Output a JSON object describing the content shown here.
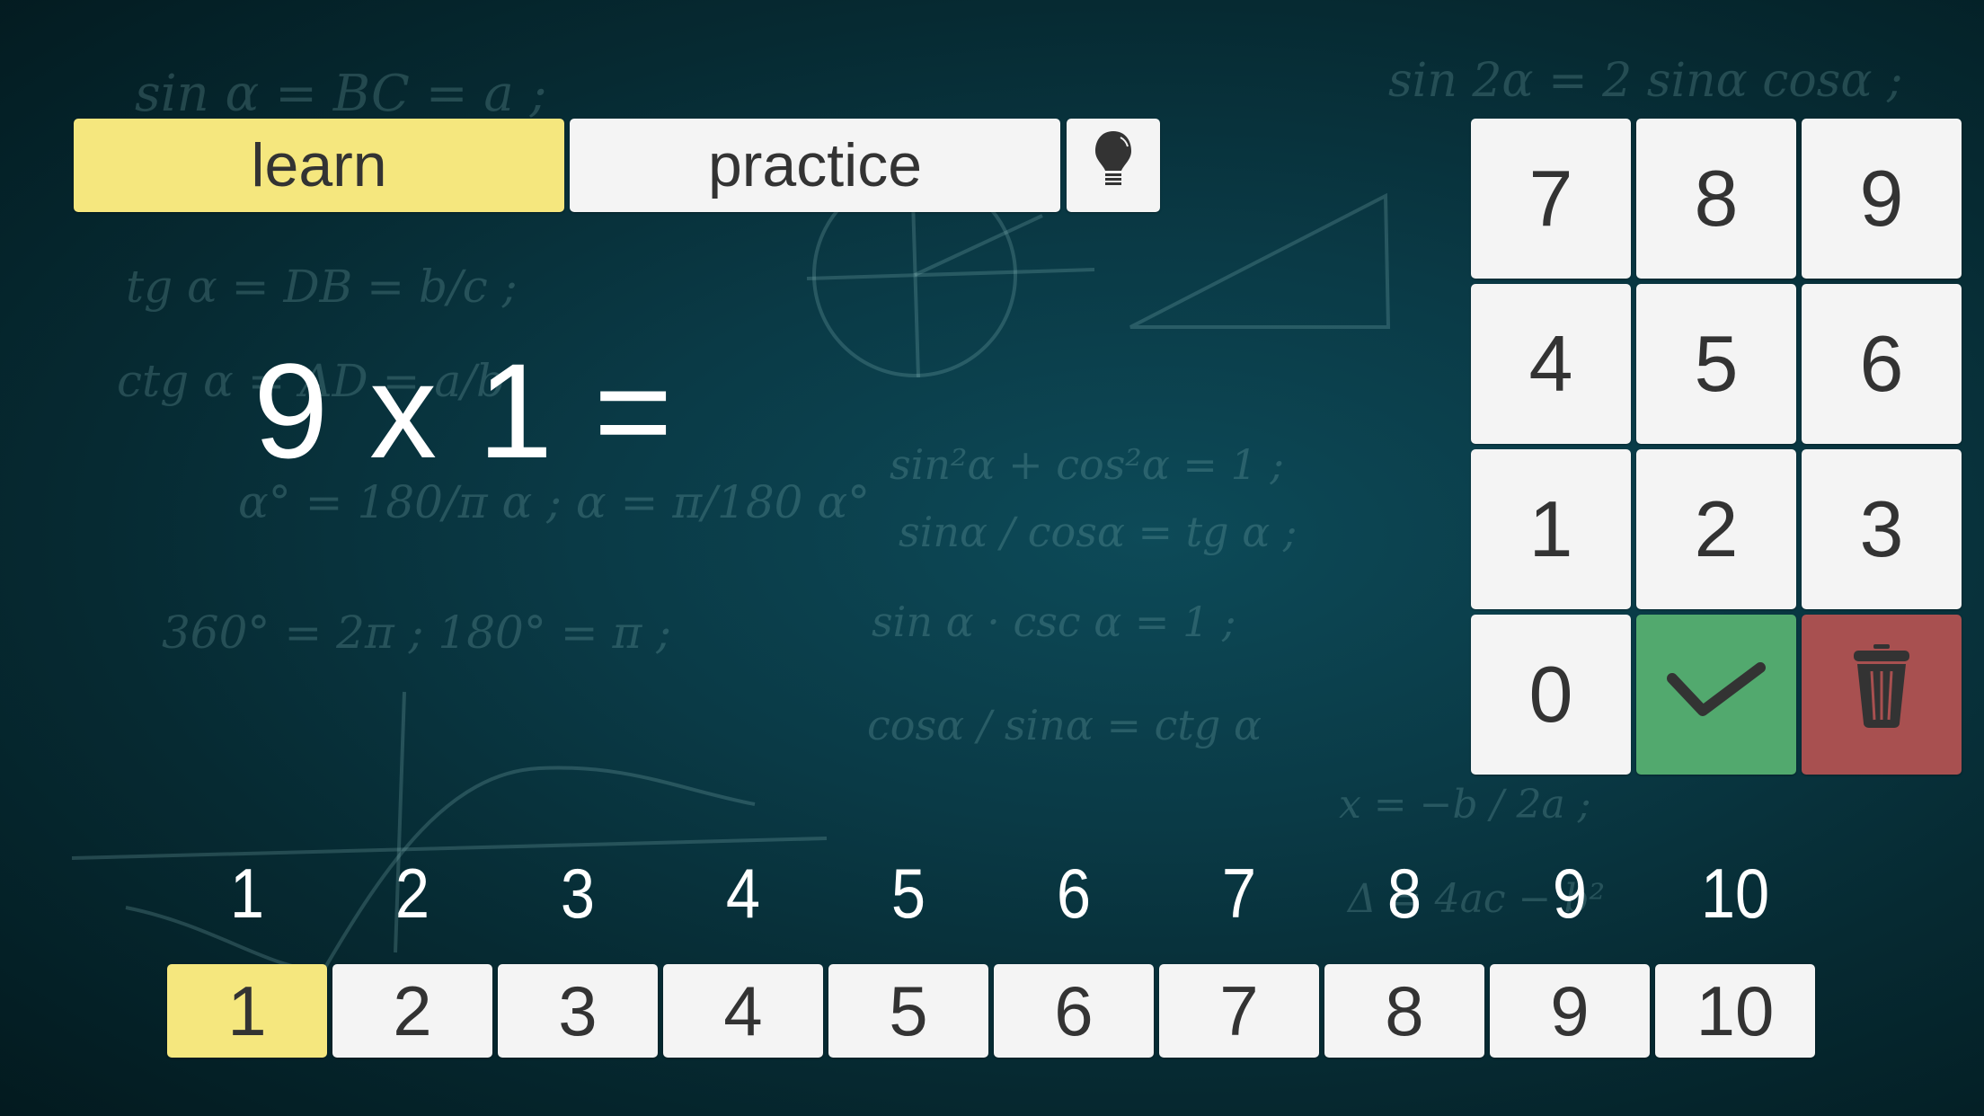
{
  "mode_tabs": {
    "learn_label": "learn",
    "practice_label": "practice",
    "active": "learn",
    "hint_icon": "lightbulb-icon"
  },
  "question": {
    "text": "9 x 1 ="
  },
  "keypad": {
    "keys": [
      "7",
      "8",
      "9",
      "4",
      "5",
      "6",
      "1",
      "2",
      "3",
      "0"
    ],
    "confirm_icon": "check-icon",
    "delete_icon": "trash-icon"
  },
  "tables": {
    "labels": [
      "1",
      "2",
      "3",
      "4",
      "5",
      "6",
      "7",
      "8",
      "9",
      "10"
    ],
    "buttons": [
      "1",
      "2",
      "3",
      "4",
      "5",
      "6",
      "7",
      "8",
      "9",
      "10"
    ],
    "active": "1"
  },
  "colors": {
    "active": "#f5e77e",
    "confirm": "#52a96e",
    "delete": "#a85050",
    "button": "#f4f4f4",
    "text_dark": "#333333"
  },
  "background_chalk": [
    "sin α = BC = a ;",
    "tg α = DB = b/c ;",
    "ctg α = AD = a/b",
    "α° = 180/π α ; α = π/180 α°",
    "360° = 2π ; 180° = π ;",
    "sin 2α = 2 sinα cosα ;",
    "sin²α + cos²α = 1 ;",
    "sinα / cosα = tg α ;",
    "sin α · csc α = 1 ;",
    "cosα / sinα = ctg α",
    "x = −b / 2a ;",
    "Δ = 4ac − b²"
  ]
}
